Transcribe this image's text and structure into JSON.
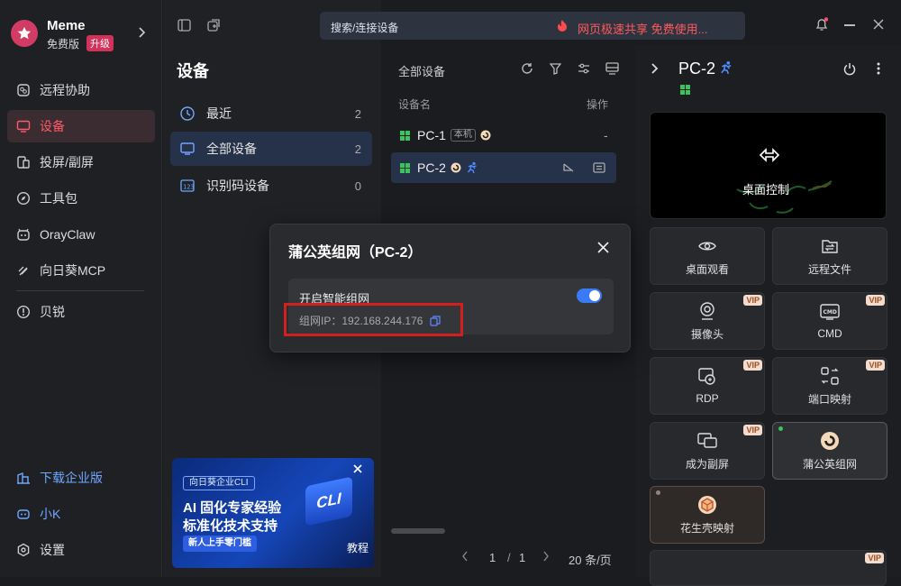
{
  "user": {
    "name": "Meme",
    "plan": "免费版",
    "upgrade": "升级"
  },
  "sidebar": {
    "items": [
      {
        "label": "远程协助"
      },
      {
        "label": "设备"
      },
      {
        "label": "投屏/副屏"
      },
      {
        "label": "工具包"
      },
      {
        "label": "OrayClaw"
      },
      {
        "label": "向日葵MCP"
      },
      {
        "label": "贝锐"
      }
    ],
    "bottom": [
      {
        "label": "下载企业版"
      },
      {
        "label": "小K"
      },
      {
        "label": "设置"
      }
    ]
  },
  "topbar": {
    "search_label": "搜索/连接设备",
    "promo": "网页极速共享 免费使用..."
  },
  "devices_panel": {
    "title": "设备",
    "filters": [
      {
        "label": "最近",
        "count": "2"
      },
      {
        "label": "全部设备",
        "count": "2"
      },
      {
        "label": "识别码设备",
        "count": "0"
      }
    ]
  },
  "ad": {
    "badge": "向日葵企业CLI",
    "line1": "AI 固化专家经验",
    "line2": "标准化技术支持",
    "cta": "新人上手零门槛",
    "big": "CLI",
    "tutorial": "教程"
  },
  "list": {
    "title": "全部设备",
    "col_name": "设备名",
    "col_action": "操作",
    "rows": [
      {
        "name": "PC-1",
        "tag": "本机",
        "action": "-"
      },
      {
        "name": "PC-2"
      }
    ],
    "pager": {
      "current": "1",
      "sep": "/",
      "total": "1",
      "per_page": "20 条/页"
    }
  },
  "detail": {
    "title": "PC-2",
    "desktop_control": "桌面控制",
    "tiles": [
      {
        "label": "桌面观看",
        "vip": ""
      },
      {
        "label": "远程文件",
        "vip": ""
      },
      {
        "label": "摄像头",
        "vip": "VIP"
      },
      {
        "label": "CMD",
        "vip": "VIP"
      },
      {
        "label": "RDP",
        "vip": "VIP"
      },
      {
        "label": "端口映射",
        "vip": "VIP"
      },
      {
        "label": "成为副屏",
        "vip": "VIP"
      },
      {
        "label": "蒲公英组网",
        "vip": ""
      },
      {
        "label": "花生壳映射",
        "vip": ""
      },
      {
        "label": "",
        "vip": "VIP"
      }
    ]
  },
  "modal": {
    "title": "蒲公英组网（PC-2）",
    "toggle_label": "开启智能组网",
    "toggle_on": true,
    "ip_label": "组网IP：",
    "ip_value": "192.168.244.176"
  },
  "colors": {
    "accent_red": "#ff5a6a",
    "toggle_blue": "#3a7bf5",
    "highlight_box": "#d41f1f"
  }
}
